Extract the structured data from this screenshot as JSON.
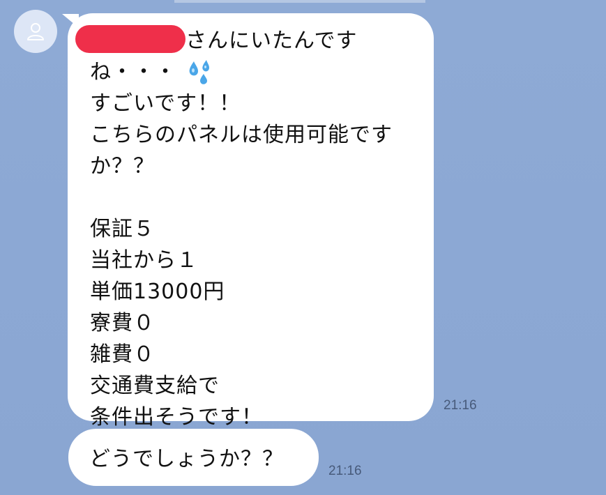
{
  "chat": {
    "messages": [
      {
        "sender_avatar_icon": "person-outline-icon",
        "first_line_visible": "さんにいたんです",
        "second_line": "ね・・・",
        "emoji_icon": "sweat-droplets-icon",
        "body": "すごいです！！\nこちらのパネルは使用可能です\nか？？\n\n保証５\n当社から１\n単価13000円\n寮費０\n雑費０\n交通費支給で\n条件出そうです！",
        "time": "21:16"
      },
      {
        "body": "どうでしょうか？？",
        "time": "21:16"
      }
    ]
  },
  "colors": {
    "background": "#8ca8d4",
    "bubble": "#ffffff",
    "redaction": "#ef2f4a"
  }
}
